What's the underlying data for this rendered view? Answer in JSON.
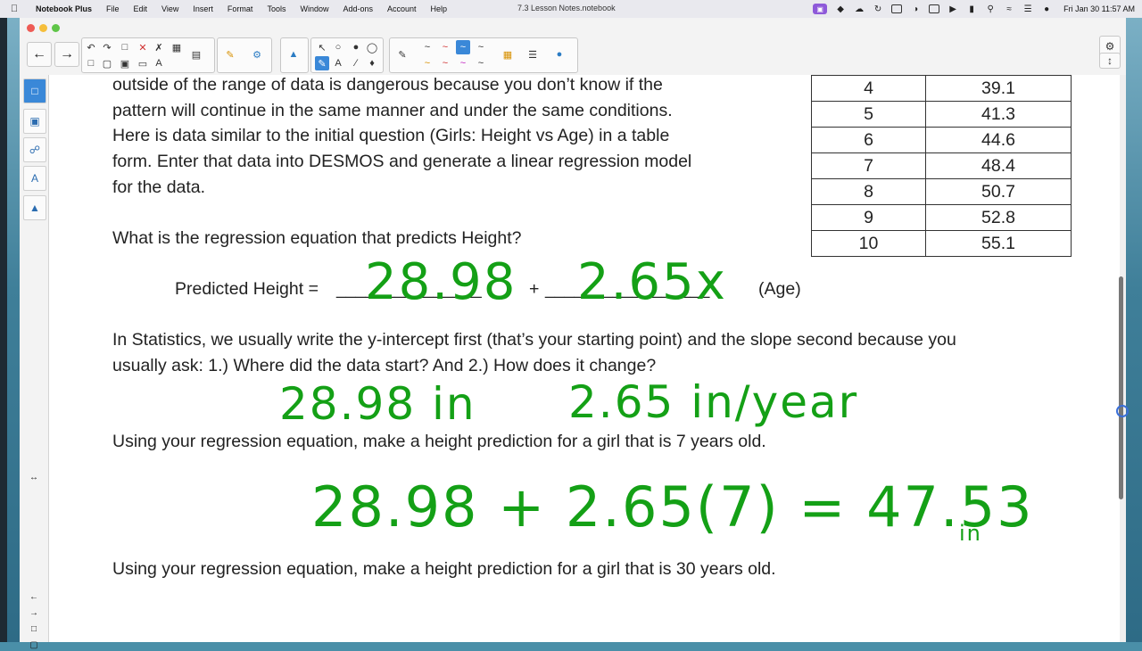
{
  "menubar": {
    "app_name": "Notebook Plus",
    "menus": [
      "File",
      "Edit",
      "View",
      "Insert",
      "Format",
      "Tools",
      "Window",
      "Add-ons",
      "Account",
      "Help"
    ],
    "doc_title": "7.3 Lesson Notes.notebook",
    "clock": "Fri Jan 30  11:57 AM"
  },
  "page": {
    "para1": [
      "outside of the range of data is dangerous because you don’t know if the",
      "pattern will continue in the same manner and under the same conditions.",
      "Here is data similar to the initial question (Girls: Height vs Age) in a table",
      "form.  Enter that data into DESMOS and generate a linear regression model",
      "for the data."
    ],
    "question1": "What is the regression equation that predicts Height?",
    "equation": {
      "label": "Predicted Height = ",
      "blank1": "_______________",
      "plus": "+",
      "blank2": "_________________",
      "suffix": "(Age)"
    },
    "para2": [
      "In Statistics, we usually write the y-intercept first (that’s your starting point) and the slope second because you",
      "usually ask: 1.) Where did the data start? And 2.) How does it change?"
    ],
    "question2": "Using your regression equation, make a height prediction for a girl that is 7 years old.",
    "question3": "Using your regression equation, make a height prediction for a girl that is 30 years old.",
    "handwriting": {
      "intercept": "28.98",
      "slope": "2.65x",
      "intercept_units": "28.98 in",
      "slope_units": "2.65 in/year",
      "prediction": "28.98 + 2.65(7) = 47.53",
      "prediction_unit": "in"
    }
  },
  "table": {
    "rows": [
      [
        "4",
        "39.1"
      ],
      [
        "5",
        "41.3"
      ],
      [
        "6",
        "44.6"
      ],
      [
        "7",
        "48.4"
      ],
      [
        "8",
        "50.7"
      ],
      [
        "9",
        "52.8"
      ],
      [
        "10",
        "55.1"
      ]
    ]
  },
  "colors": {
    "ink_green": "#14a016",
    "accent_blue": "#3a88d8"
  },
  "icons": {
    "back": "back-arrow-icon",
    "forward": "forward-arrow-icon",
    "settings": "gear-icon",
    "expand": "vertical-arrows-icon"
  }
}
